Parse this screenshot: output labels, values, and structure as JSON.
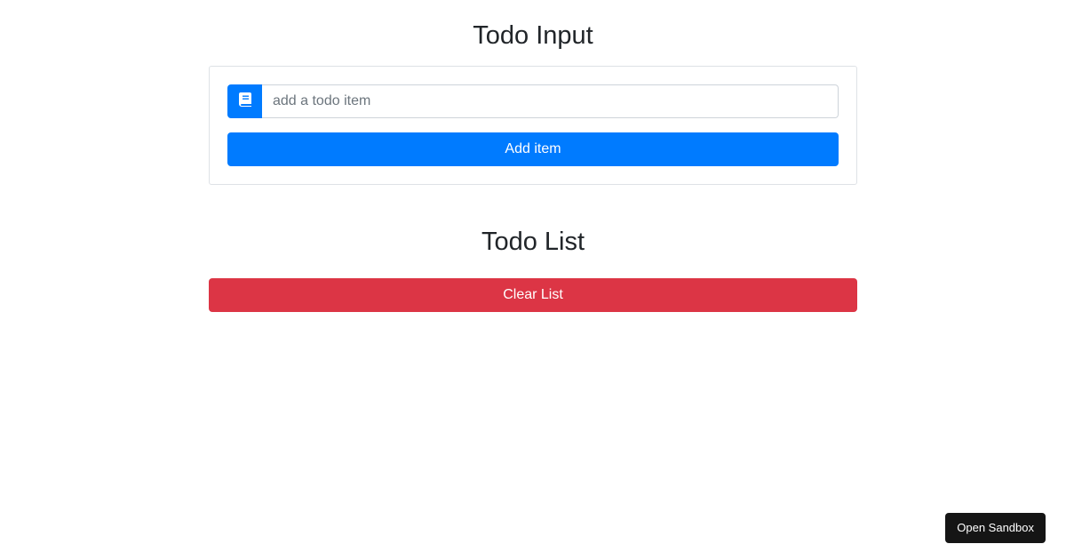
{
  "todo_input": {
    "title": "Todo Input",
    "input_value": "",
    "input_placeholder": "add a todo item",
    "input_icon": "book-icon",
    "add_button_label": "Add item"
  },
  "todo_list": {
    "title": "Todo List",
    "items": [],
    "clear_button_label": "Clear List"
  },
  "sandbox": {
    "open_label": "Open Sandbox"
  },
  "colors": {
    "primary": "#007bff",
    "danger": "#dc3545",
    "sandbox_bg": "#151515",
    "card_border": "#dee2e6"
  }
}
